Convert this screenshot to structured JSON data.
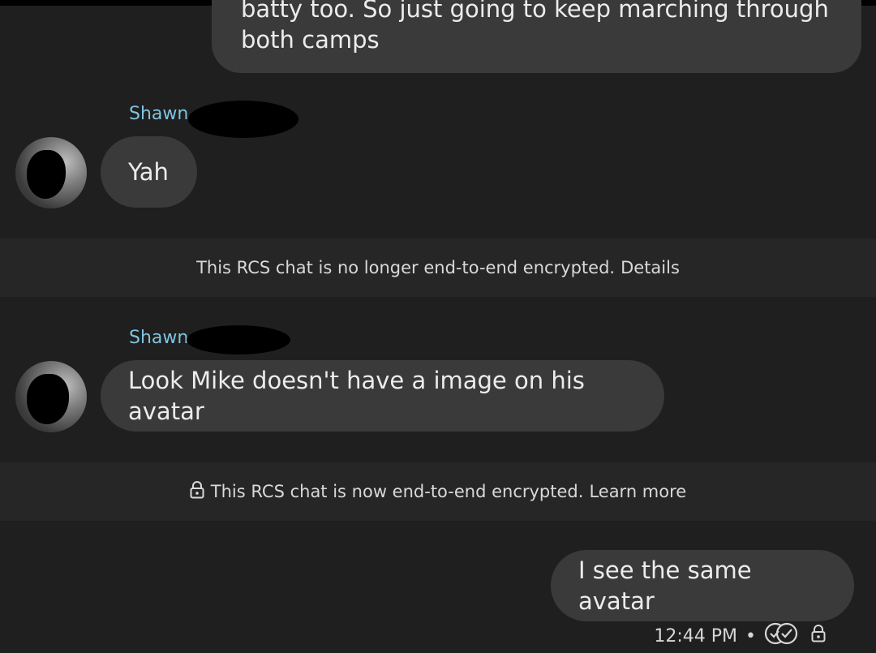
{
  "messages": {
    "outgoing_top": {
      "line1": "batty too. So just going to keep marching through",
      "line2": "both camps"
    },
    "incoming_1": {
      "sender": "Shawn",
      "text": "Yah"
    },
    "incoming_2": {
      "sender": "Shawn",
      "text": "Look Mike doesn't have a image on his avatar"
    },
    "outgoing_bottom": {
      "text": "I see the same avatar",
      "time": "12:44 PM",
      "separator": "•"
    }
  },
  "banners": {
    "not_encrypted": {
      "text": "This RCS chat is no longer end-to-end encrypted.",
      "link": "Details"
    },
    "encrypted": {
      "text": "This RCS chat is now end-to-end encrypted.",
      "link": "Learn more"
    }
  },
  "icons": {
    "lock": "lock-icon",
    "read_receipt": "double-check-circle-icon"
  },
  "colors": {
    "background": "#1f1f1f",
    "bubble": "#3a3a3a",
    "banner": "#262626",
    "sender_name": "#7fc4e0"
  }
}
